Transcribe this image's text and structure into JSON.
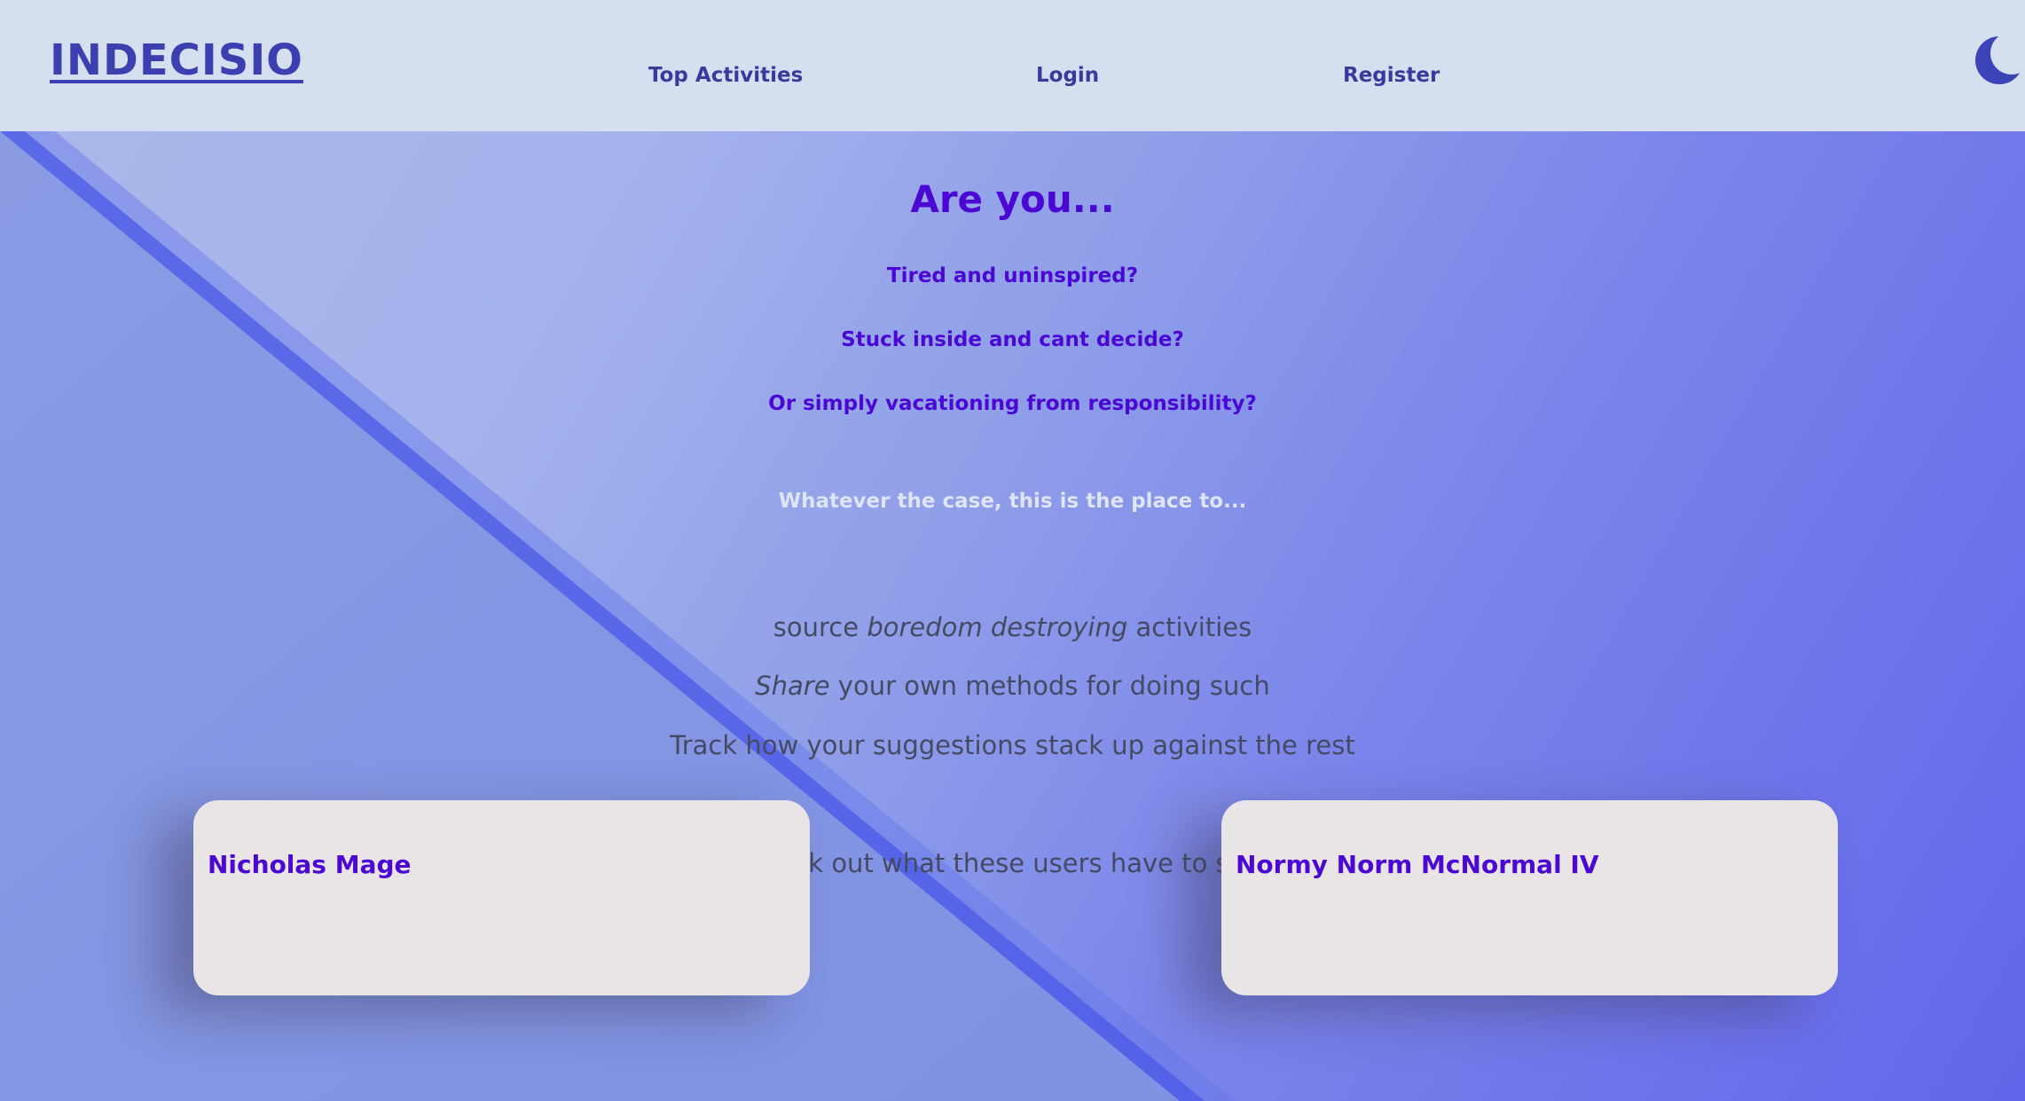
{
  "header": {
    "logo": "INDECISIO",
    "nav": [
      {
        "label": "Top Activities"
      },
      {
        "label": "Login"
      },
      {
        "label": "Register"
      }
    ],
    "theme_toggle_icon": "moon-icon"
  },
  "hero": {
    "title": "Are you...",
    "questions": [
      "Tired and uninspired?",
      "Stuck inside and cant decide?",
      "Or simply vacationing from responsibility?"
    ],
    "lead": "Whatever the case, this is the place to..."
  },
  "features": {
    "f1": {
      "pre": "source ",
      "em": "boredom destroying",
      "post": " activities"
    },
    "f2": {
      "em": "Share",
      "post": " your own methods for doing such"
    },
    "f3": {
      "text": "Track how your suggestions stack up against the rest"
    }
  },
  "testimonials": {
    "heading": "Check out what these users have to say...",
    "cards": [
      {
        "name": "Nicholas Mage"
      },
      {
        "name": "Normy Norm McNormal IV"
      }
    ]
  },
  "colors": {
    "header_bg": "#d6dff0",
    "brand": "#3b3fb0",
    "accent": "#4b08d4",
    "body_text": "#454a63",
    "card_bg": "#e9e4e6"
  }
}
